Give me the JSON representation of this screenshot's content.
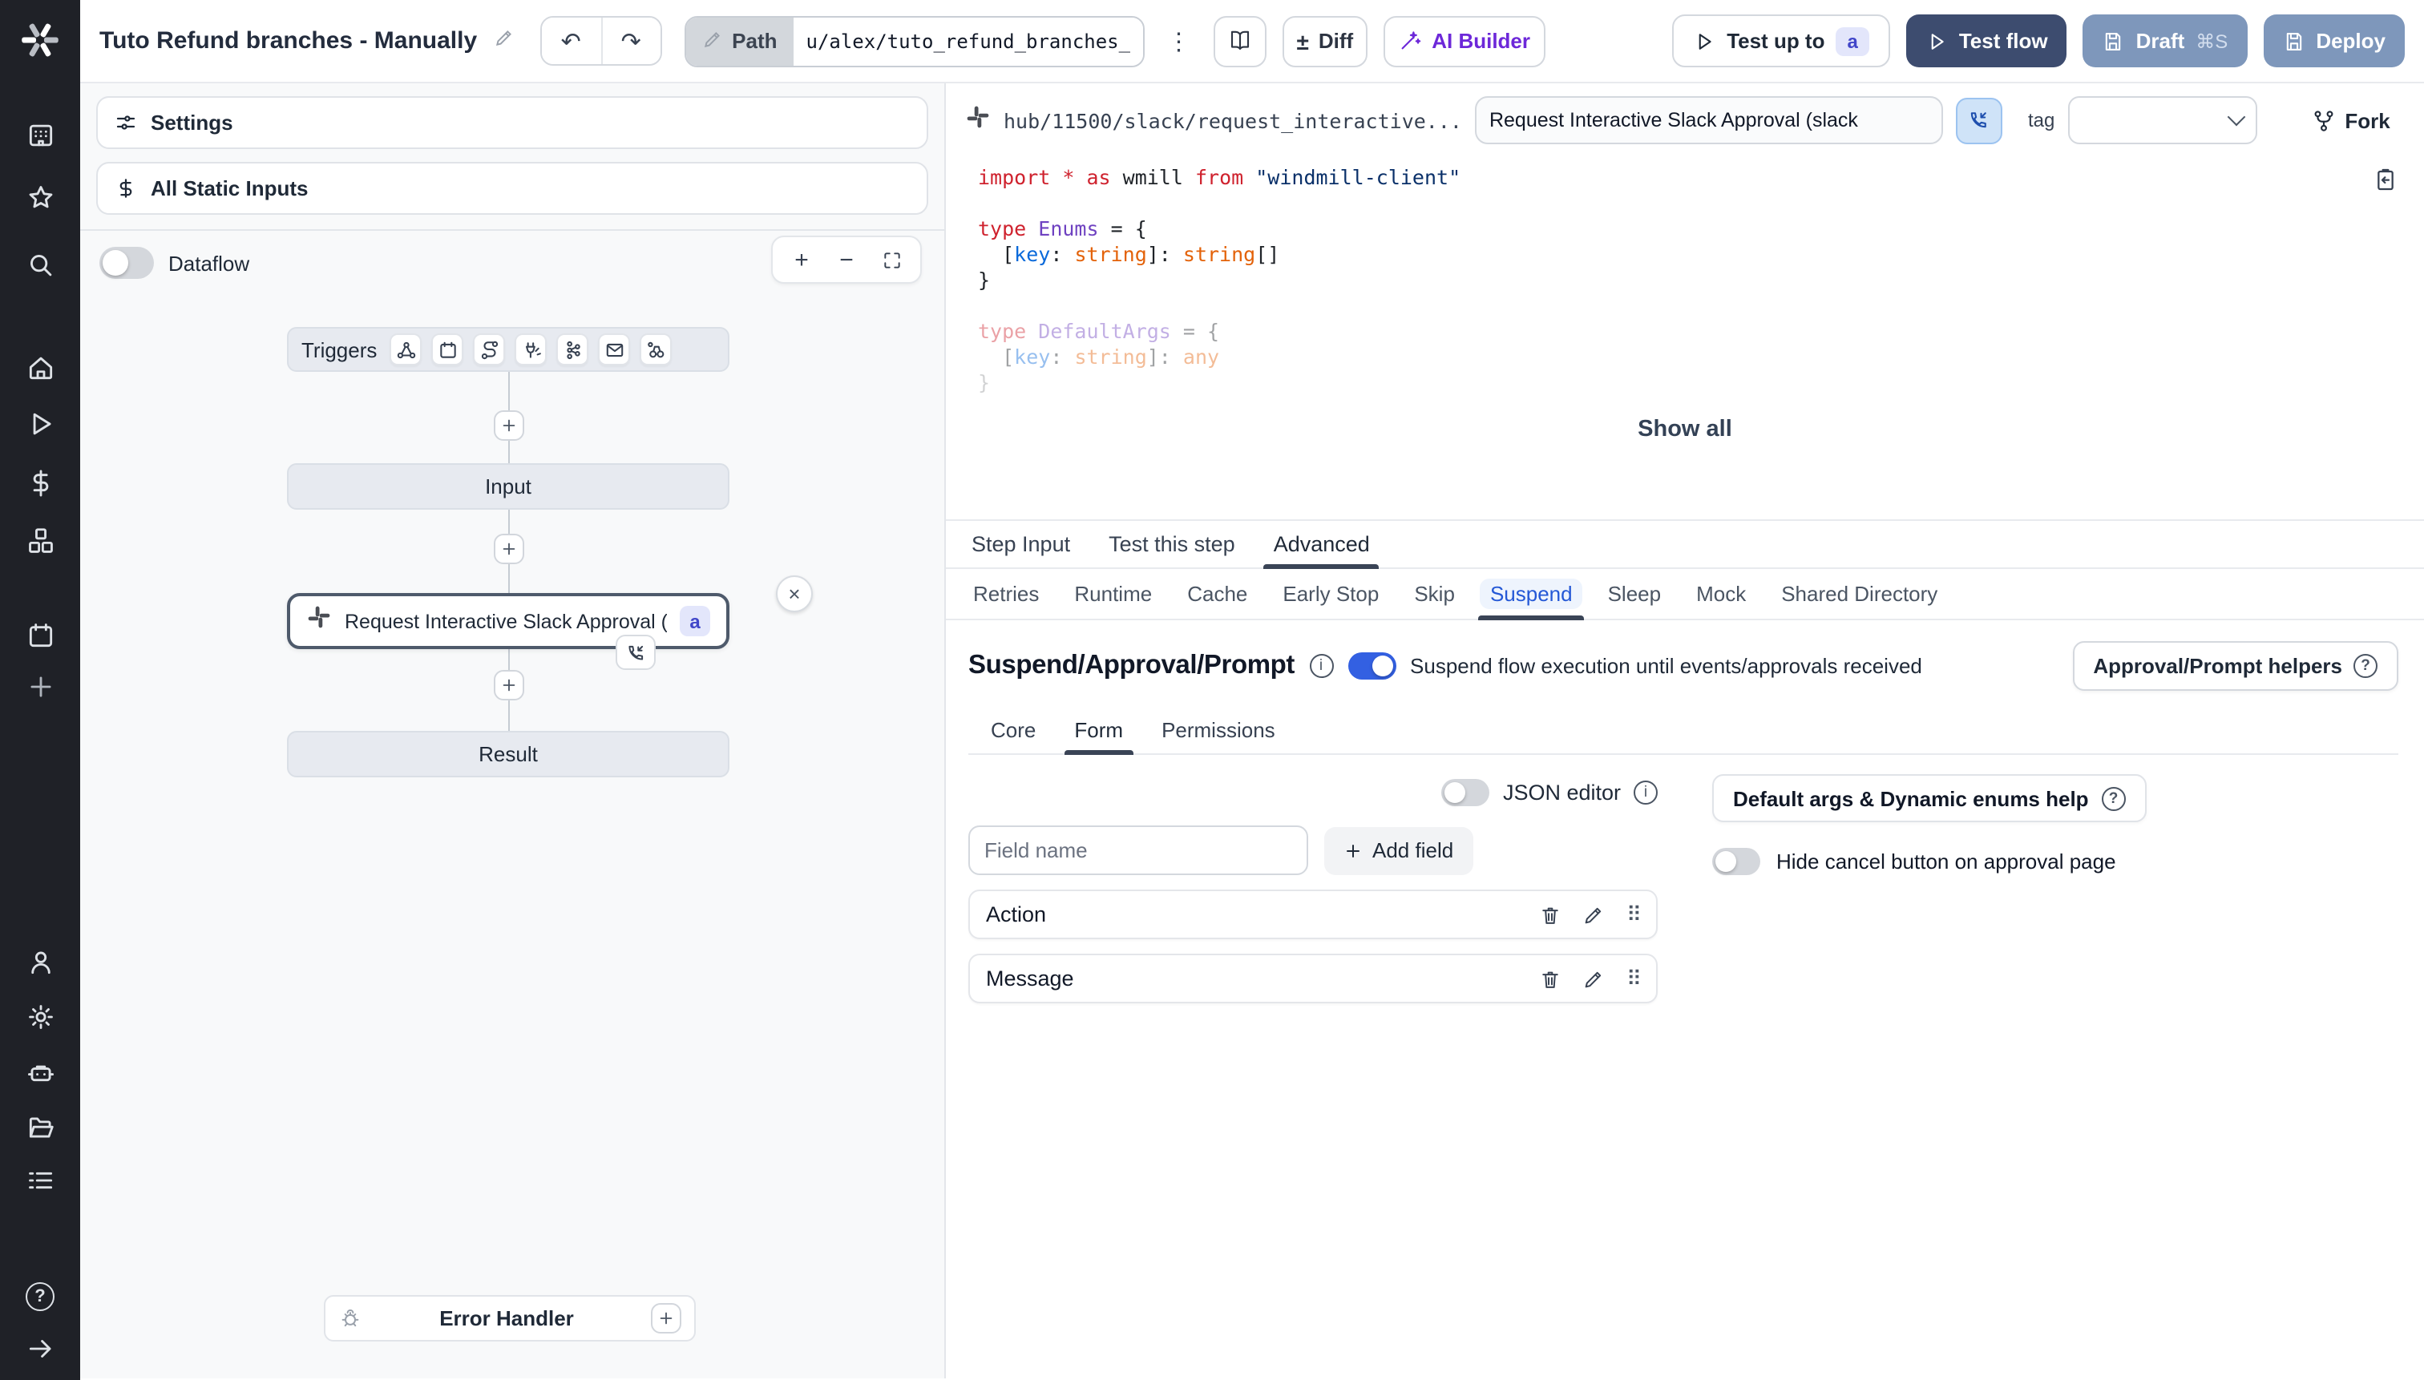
{
  "topbar": {
    "title": "Tuto Refund branches - Manually",
    "undo_glyph": "↶",
    "redo_glyph": "↷",
    "path_label": "Path",
    "path_value": "u/alex/tuto_refund_branches__",
    "kebab_glyph": "⋮",
    "diff_label": "Diff",
    "diff_glyph": "±",
    "ai_builder_label": "AI Builder",
    "test_up_to_label": "Test up to",
    "test_up_to_badge": "a",
    "test_flow_label": "Test flow",
    "draft_label": "Draft",
    "draft_shortcut": "⌘S",
    "deploy_label": "Deploy"
  },
  "sidebar": {
    "icons": [
      "windmill-logo",
      "workspace-icon",
      "star-icon",
      "search-icon",
      "home-icon",
      "runs-icon",
      "variables-icon",
      "resources-icon",
      "schedules-icon",
      "add-icon",
      "users-icon",
      "settings-icon",
      "workers-icon",
      "folders-icon",
      "audit-logs-icon",
      "help-icon",
      "expand-icon"
    ],
    "help_glyph": "?"
  },
  "flow_panel": {
    "settings_label": "Settings",
    "static_inputs_label": "All Static Inputs",
    "dataflow_label": "Dataflow",
    "zoom_in_glyph": "+",
    "zoom_out_glyph": "−"
  },
  "graph": {
    "triggers_label": "Triggers",
    "trigger_icons": [
      "webhook-icon",
      "schedule-icon",
      "http-route-icon",
      "websocket-icon",
      "kafka-icon",
      "email-icon",
      "poll-icon"
    ],
    "input_label": "Input",
    "step_label": "Request Interactive Slack Approval (...",
    "step_badge": "a",
    "close_glyph": "×",
    "result_label": "Result",
    "error_handler_label": "Error Handler"
  },
  "right_panel": {
    "hub_path": "hub/11500/slack/request_interactive...",
    "title_value": "Request Interactive Slack Approval (slack",
    "tag_label": "tag",
    "fork_label": "Fork",
    "show_all_label": "Show all",
    "tabs": [
      "Step Input",
      "Test this step",
      "Advanced"
    ],
    "active_tab": "Advanced",
    "subtabs": [
      "Retries",
      "Runtime",
      "Cache",
      "Early Stop",
      "Skip",
      "Suspend",
      "Sleep",
      "Mock",
      "Shared Directory"
    ],
    "active_subtab": "Suspend",
    "code": {
      "faded_from": 6,
      "lines": [
        [
          [
            "import ",
            "kw"
          ],
          [
            "* ",
            "kw"
          ],
          [
            "as ",
            "kw"
          ],
          [
            "wmill ",
            "plain"
          ],
          [
            "from ",
            "kw"
          ],
          [
            "\"windmill-client\"",
            "str"
          ]
        ],
        [],
        [
          [
            "type ",
            "kw"
          ],
          [
            "Enums",
            "type"
          ],
          [
            " = {",
            "plain"
          ]
        ],
        [
          [
            "  [",
            "plain"
          ],
          [
            "key",
            "key"
          ],
          [
            ": ",
            "plain"
          ],
          [
            "string",
            "tname"
          ],
          [
            "]: ",
            "plain"
          ],
          [
            "string",
            "tname"
          ],
          [
            "[]",
            "plain"
          ]
        ],
        [
          [
            "}",
            "plain"
          ]
        ],
        [],
        [
          [
            "type ",
            "kw"
          ],
          [
            "DefaultArgs",
            "type"
          ],
          [
            " = {",
            "plain"
          ]
        ],
        [
          [
            "  [",
            "plain"
          ],
          [
            "key",
            "key"
          ],
          [
            ": ",
            "plain"
          ],
          [
            "string",
            "tname"
          ],
          [
            "]: ",
            "plain"
          ],
          [
            "any",
            "tname"
          ]
        ],
        [
          [
            "}",
            "plain"
          ]
        ]
      ]
    },
    "suspend": {
      "heading": "Suspend/Approval/Prompt",
      "toggle_description": "Suspend flow execution until events/approvals received",
      "helpers_label": "Approval/Prompt helpers",
      "tabs": [
        "Core",
        "Form",
        "Permissions"
      ],
      "active_tab": "Form",
      "json_editor_label": "JSON editor",
      "field_name_placeholder": "Field name",
      "add_field_label": "Add field",
      "fields": [
        {
          "label": "Action"
        },
        {
          "label": "Message"
        }
      ],
      "default_args_button": "Default args & Dynamic enums help",
      "hide_cancel_label": "Hide cancel button on approval page"
    }
  },
  "colors": {
    "accent_blue": "#3360e2",
    "navy_button": "#3d4c6f",
    "slate_button": "#7e97bb",
    "badge_bg": "#e3e6fb",
    "badge_text": "#4146c9",
    "rail_bg": "#1f2127",
    "ai_purple": "#6d28d9",
    "active_subtab_text": "#2458d6"
  }
}
